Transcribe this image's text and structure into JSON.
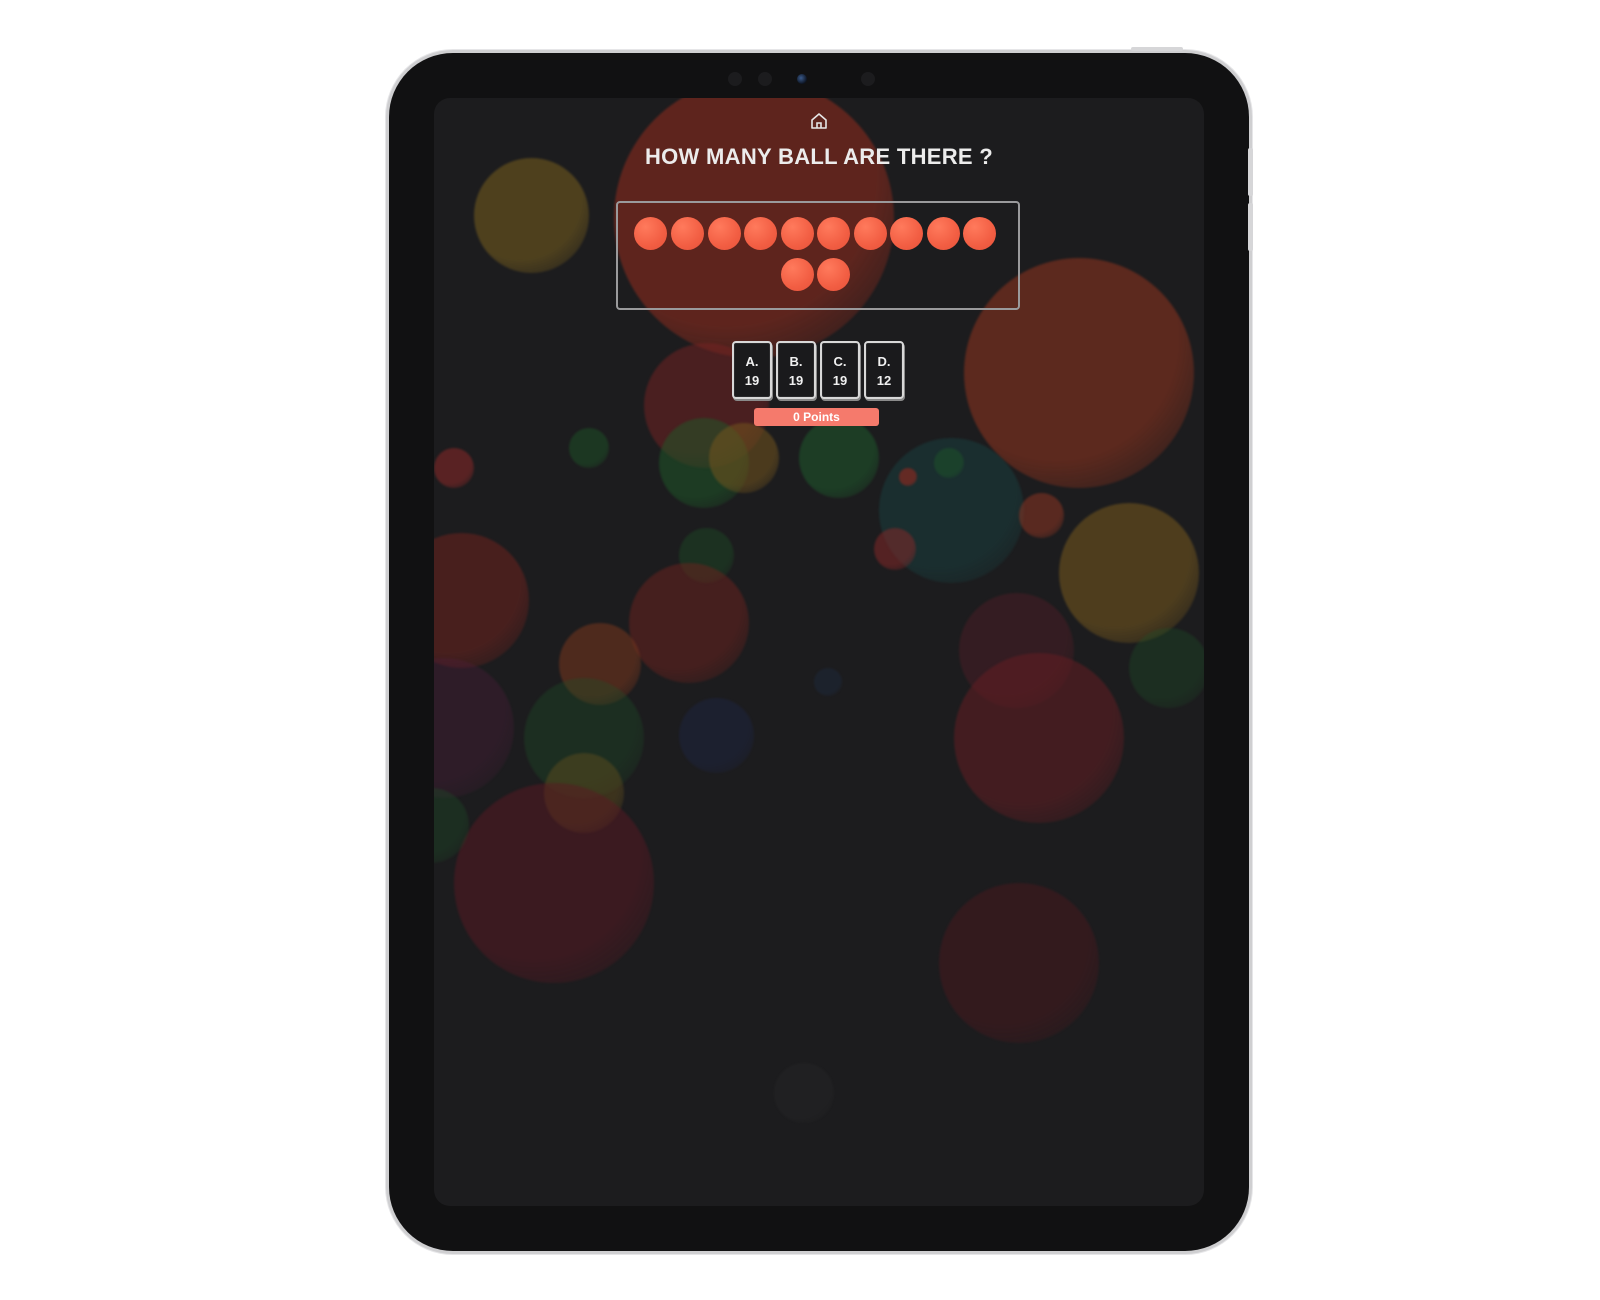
{
  "app": {
    "home_icon": "home-icon"
  },
  "question": {
    "text": "HOW MANY BALL ARE THERE ?"
  },
  "balls": {
    "count": 12,
    "color": "#f25e43"
  },
  "answers": [
    {
      "letter": "A.",
      "value": "19"
    },
    {
      "letter": "B.",
      "value": "19"
    },
    {
      "letter": "C.",
      "value": "19"
    },
    {
      "letter": "D.",
      "value": "12"
    }
  ],
  "score": {
    "label": "0 Points",
    "color": "#f57a6c"
  },
  "theme": {
    "screen_background": "#1c1c1e",
    "device_frame": "#111112"
  }
}
